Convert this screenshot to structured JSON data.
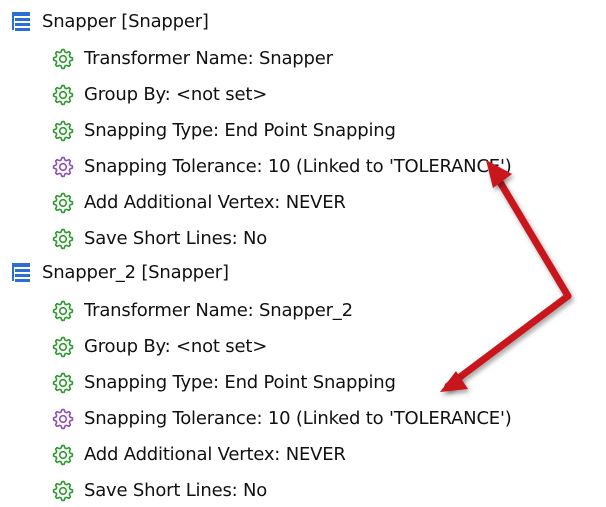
{
  "transformers": [
    {
      "header": "Snapper [Snapper]",
      "icon": "transformer-list-icon",
      "params": [
        {
          "label": "Transformer Name: Snapper",
          "icon": "gear-icon",
          "color": "#2e9a2e"
        },
        {
          "label": "Group By: <not set>",
          "icon": "gear-icon",
          "color": "#2e9a2e"
        },
        {
          "label": "Snapping Type: End Point Snapping",
          "icon": "gear-icon",
          "color": "#2e9a2e"
        },
        {
          "label": "Snapping Tolerance: 10 (Linked to 'TOLERANCE')",
          "icon": "gear-icon",
          "color": "#8e4fb8"
        },
        {
          "label": "Add Additional Vertex: NEVER",
          "icon": "gear-icon",
          "color": "#2e9a2e"
        },
        {
          "label": "Save Short Lines: No",
          "icon": "gear-icon",
          "color": "#2e9a2e"
        }
      ]
    },
    {
      "header": "Snapper_2 [Snapper]",
      "icon": "transformer-list-icon",
      "params": [
        {
          "label": "Transformer Name: Snapper_2",
          "icon": "gear-icon",
          "color": "#2e9a2e"
        },
        {
          "label": "Group By: <not set>",
          "icon": "gear-icon",
          "color": "#2e9a2e"
        },
        {
          "label": "Snapping Type: End Point Snapping",
          "icon": "gear-icon",
          "color": "#2e9a2e"
        },
        {
          "label": "Snapping Tolerance: 10 (Linked to 'TOLERANCE')",
          "icon": "gear-icon",
          "color": "#8e4fb8"
        },
        {
          "label": "Add Additional Vertex: NEVER",
          "icon": "gear-icon",
          "color": "#2e9a2e"
        },
        {
          "label": "Save Short Lines: No",
          "icon": "gear-icon",
          "color": "#2e9a2e"
        }
      ]
    }
  ],
  "colors": {
    "header_icon": "#2b6fd6",
    "published_param": "#2e9a2e",
    "linked_param": "#8e4fb8",
    "annotation_arrow": "#c8141e"
  },
  "annotation": {
    "icon": "double-headed-arrow-icon"
  }
}
